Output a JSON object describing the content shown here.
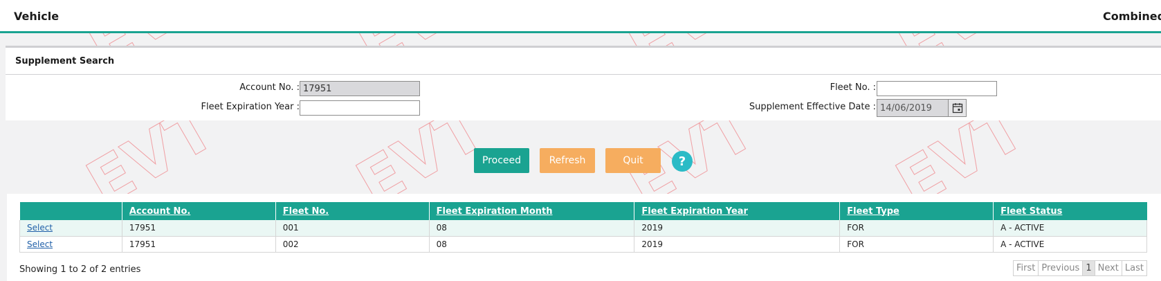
{
  "header": {
    "left_title": "Vehicle",
    "right_title": "Combined"
  },
  "search": {
    "panel_title": "Supplement Search",
    "account_label": "Account No. :",
    "account_value": "17951",
    "fleet_exp_year_label": "Fleet Expiration Year :",
    "fleet_exp_year_value": "",
    "fleet_no_label": "Fleet No. :",
    "fleet_no_value": "",
    "supp_eff_date_label": "Supplement Effective Date :",
    "supp_eff_date_value": "14/06/2019"
  },
  "actions": {
    "proceed": "Proceed",
    "refresh": "Refresh",
    "quit": "Quit",
    "help": "?"
  },
  "table": {
    "columns": [
      "",
      "Account No.",
      "Fleet No.",
      "Fleet Expiration Month",
      "Fleet Expiration Year",
      "Fleet Type",
      "Fleet Status"
    ],
    "rows": [
      [
        "Select",
        "17951",
        "001",
        "08",
        "2019",
        "FOR",
        "A - ACTIVE"
      ],
      [
        "Select",
        "17951",
        "002",
        "08",
        "2019",
        "FOR",
        "A - ACTIVE"
      ]
    ]
  },
  "footer": {
    "entries_info": "Showing 1 to 2 of 2 entries",
    "pager": {
      "first": "First",
      "previous": "Previous",
      "current_page": "1",
      "next": "Next",
      "last": "Last"
    }
  },
  "watermark_text": "EVT",
  "colors": {
    "accent": "#1aa391",
    "warning_button": "#f6ad5f",
    "help": "#2bbbc6"
  }
}
